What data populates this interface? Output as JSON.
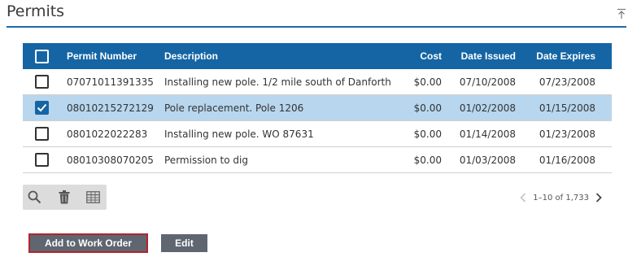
{
  "panel": {
    "title": "Permits"
  },
  "grid": {
    "columns": [
      "Permit Number",
      "Description",
      "Cost",
      "Date Issued",
      "Date Expires"
    ],
    "rows": [
      {
        "permit_number": "07071011391335",
        "description": "Installing new pole. 1/2 mile south of Danforth",
        "cost": "$0.00",
        "date_issued": "07/10/2008",
        "date_expires": "07/23/2008",
        "checked": false
      },
      {
        "permit_number": "08010215272129",
        "description": "Pole replacement. Pole 1206",
        "cost": "$0.00",
        "date_issued": "01/02/2008",
        "date_expires": "01/15/2008",
        "checked": true
      },
      {
        "permit_number": "0801022022283",
        "description": "Installing new pole. WO 87631",
        "cost": "$0.00",
        "date_issued": "01/14/2008",
        "date_expires": "01/23/2008",
        "checked": false
      },
      {
        "permit_number": "08010308070205",
        "description": "Permission to dig",
        "cost": "$0.00",
        "date_issued": "01/03/2008",
        "date_expires": "01/16/2008",
        "checked": false
      }
    ]
  },
  "toolbar": {
    "icons": [
      "search-icon",
      "trash-icon",
      "table-icon"
    ]
  },
  "pager": {
    "range_text": "1–10 of 1,733"
  },
  "actions": {
    "add_label": "Add to Work Order",
    "edit_label": "Edit"
  },
  "colors": {
    "header_bg": "#1565a4",
    "selected_row": "#b8d6ee",
    "button_bg": "#5f6670",
    "focus_border": "#b3242c"
  }
}
